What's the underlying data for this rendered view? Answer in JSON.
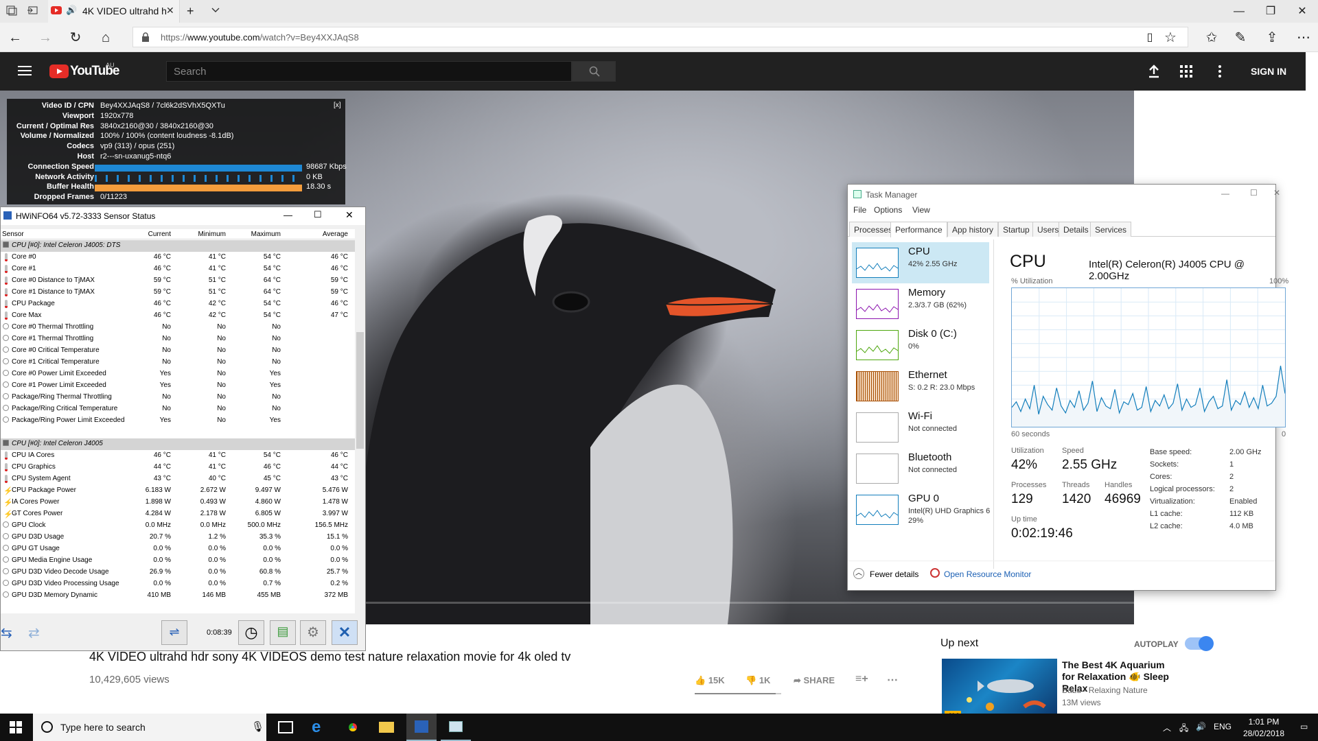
{
  "browser": {
    "tab_title": "4K VIDEO ultrahd h",
    "url_prefix": "https://",
    "url_domain": "www.youtube.com",
    "url_path": "/watch?v=Bey4XXJAqS8"
  },
  "youtube": {
    "brand": "YouTube",
    "country": "AU",
    "search_placeholder": "Search",
    "sign_in": "SIGN IN",
    "stats": [
      {
        "label": "Video ID / CPN",
        "value": "Bey4XXJAqS8 / 7cl6k2dSVhX5QXTu"
      },
      {
        "label": "Viewport",
        "value": "1920x778"
      },
      {
        "label": "Current / Optimal Res",
        "value": "3840x2160@30 / 3840x2160@30"
      },
      {
        "label": "Volume / Normalized",
        "value": "100% / 100% (content loudness -8.1dB)"
      },
      {
        "label": "Codecs",
        "value": "vp9 (313) / opus (251)"
      },
      {
        "label": "Host",
        "value": "r2---sn-uxanug5-ntq6"
      },
      {
        "label": "Connection Speed",
        "value": "98687 Kbps"
      },
      {
        "label": "Network Activity",
        "value": "0 KB"
      },
      {
        "label": "Buffer Health",
        "value": "18.30 s"
      },
      {
        "label": "Dropped Frames",
        "value": "0/11223"
      }
    ],
    "stats_close": "[x]",
    "video_title": "4K VIDEO ultrahd hdr sony 4K VIDEOS demo test nature relaxation movie for 4k oled tv",
    "views": "10,429,605 views",
    "likes": "15K",
    "dislikes": "1K",
    "share": "SHARE",
    "up_next": "Up next",
    "autoplay": "AUTOPLAY",
    "rec": {
      "title": "The Best 4K Aquarium for Relaxation 🐠 Sleep Relax",
      "channel": "BaLu - Relaxing Nature",
      "views": "13M views",
      "badge": "4K"
    }
  },
  "hwinfo": {
    "title": "HWiNFO64 v5.72-3333 Sensor Status",
    "headers": [
      "Sensor",
      "Current",
      "Minimum",
      "Maximum",
      "Average"
    ],
    "rows": [
      {
        "type": "section",
        "name": "CPU [#0]: Intel Celeron J4005: DTS"
      },
      {
        "type": "temp",
        "name": "Core #0",
        "cur": "46 °C",
        "min": "41 °C",
        "max": "54 °C",
        "avg": "46 °C"
      },
      {
        "type": "temp",
        "name": "Core #1",
        "cur": "46 °C",
        "min": "41 °C",
        "max": "54 °C",
        "avg": "46 °C"
      },
      {
        "type": "temp",
        "name": "Core #0 Distance to TjMAX",
        "cur": "59 °C",
        "min": "51 °C",
        "max": "64 °C",
        "avg": "59 °C"
      },
      {
        "type": "temp",
        "name": "Core #1 Distance to TjMAX",
        "cur": "59 °C",
        "min": "51 °C",
        "max": "64 °C",
        "avg": "59 °C"
      },
      {
        "type": "temp",
        "name": "CPU Package",
        "cur": "46 °C",
        "min": "42 °C",
        "max": "54 °C",
        "avg": "46 °C"
      },
      {
        "type": "temp",
        "name": "Core Max",
        "cur": "46 °C",
        "min": "42 °C",
        "max": "54 °C",
        "avg": "47 °C"
      },
      {
        "type": "flag",
        "name": "Core #0 Thermal Throttling",
        "cur": "No",
        "min": "No",
        "max": "No",
        "avg": ""
      },
      {
        "type": "flag",
        "name": "Core #1 Thermal Throttling",
        "cur": "No",
        "min": "No",
        "max": "No",
        "avg": ""
      },
      {
        "type": "flag",
        "name": "Core #0 Critical Temperature",
        "cur": "No",
        "min": "No",
        "max": "No",
        "avg": ""
      },
      {
        "type": "flag",
        "name": "Core #1 Critical Temperature",
        "cur": "No",
        "min": "No",
        "max": "No",
        "avg": ""
      },
      {
        "type": "flag",
        "name": "Core #0 Power Limit Exceeded",
        "cur": "Yes",
        "min": "No",
        "max": "Yes",
        "avg": ""
      },
      {
        "type": "flag",
        "name": "Core #1 Power Limit Exceeded",
        "cur": "Yes",
        "min": "No",
        "max": "Yes",
        "avg": ""
      },
      {
        "type": "flag",
        "name": "Package/Ring Thermal Throttling",
        "cur": "No",
        "min": "No",
        "max": "No",
        "avg": ""
      },
      {
        "type": "flag",
        "name": "Package/Ring Critical Temperature",
        "cur": "No",
        "min": "No",
        "max": "No",
        "avg": ""
      },
      {
        "type": "flag",
        "name": "Package/Ring Power Limit Exceeded",
        "cur": "Yes",
        "min": "No",
        "max": "Yes",
        "avg": ""
      },
      {
        "type": "blank",
        "name": ""
      },
      {
        "type": "section",
        "name": "CPU [#0]: Intel Celeron J4005"
      },
      {
        "type": "temp",
        "name": "CPU IA Cores",
        "cur": "46 °C",
        "min": "41 °C",
        "max": "54 °C",
        "avg": "46 °C"
      },
      {
        "type": "temp",
        "name": "CPU Graphics",
        "cur": "44 °C",
        "min": "41 °C",
        "max": "46 °C",
        "avg": "44 °C"
      },
      {
        "type": "temp",
        "name": "CPU System Agent",
        "cur": "43 °C",
        "min": "40 °C",
        "max": "45 °C",
        "avg": "43 °C"
      },
      {
        "type": "power",
        "name": "CPU Package Power",
        "cur": "6.183 W",
        "min": "2.672 W",
        "max": "9.497 W",
        "avg": "5.476 W"
      },
      {
        "type": "power",
        "name": "IA Cores Power",
        "cur": "1.898 W",
        "min": "0.493 W",
        "max": "4.860 W",
        "avg": "1.478 W"
      },
      {
        "type": "power",
        "name": "GT Cores Power",
        "cur": "4.284 W",
        "min": "2.178 W",
        "max": "6.805 W",
        "avg": "3.997 W"
      },
      {
        "type": "flag",
        "name": "GPU Clock",
        "cur": "0.0 MHz",
        "min": "0.0 MHz",
        "max": "500.0 MHz",
        "avg": "156.5 MHz"
      },
      {
        "type": "flag",
        "name": "GPU D3D Usage",
        "cur": "20.7 %",
        "min": "1.2 %",
        "max": "35.3 %",
        "avg": "15.1 %"
      },
      {
        "type": "flag",
        "name": "GPU GT Usage",
        "cur": "0.0 %",
        "min": "0.0 %",
        "max": "0.0 %",
        "avg": "0.0 %"
      },
      {
        "type": "flag",
        "name": "GPU Media Engine Usage",
        "cur": "0.0 %",
        "min": "0.0 %",
        "max": "0.0 %",
        "avg": "0.0 %"
      },
      {
        "type": "flag",
        "name": "GPU D3D Video Decode Usage",
        "cur": "26.9 %",
        "min": "0.0 %",
        "max": "60.8 %",
        "avg": "25.7 %"
      },
      {
        "type": "flag",
        "name": "GPU D3D Video Processing Usage",
        "cur": "0.0 %",
        "min": "0.0 %",
        "max": "0.7 %",
        "avg": "0.2 %"
      },
      {
        "type": "flag",
        "name": "GPU D3D Memory Dynamic",
        "cur": "410 MB",
        "min": "146 MB",
        "max": "455 MB",
        "avg": "372 MB"
      }
    ],
    "timer": "0:08:39"
  },
  "taskmgr": {
    "title": "Task Manager",
    "menu": [
      "File",
      "Options",
      "View"
    ],
    "tabs": [
      "Processes",
      "Performance",
      "App history",
      "Startup",
      "Users",
      "Details",
      "Services"
    ],
    "active_tab": "Performance",
    "items": [
      {
        "name": "CPU",
        "sub": "42% 2.55 GHz",
        "color": "#117dbb"
      },
      {
        "name": "Memory",
        "sub": "2.3/3.7 GB (62%)",
        "color": "#8b12ae"
      },
      {
        "name": "Disk 0 (C:)",
        "sub": "0%",
        "color": "#4da60c"
      },
      {
        "name": "Ethernet",
        "sub": "S: 0.2  R: 23.0 Mbps",
        "color": "#a74f01"
      },
      {
        "name": "Wi-Fi",
        "sub": "Not connected",
        "color": "#aaaaaa"
      },
      {
        "name": "Bluetooth",
        "sub": "Not connected",
        "color": "#aaaaaa"
      },
      {
        "name": "GPU 0",
        "sub": "Intel(R) UHD Graphics 6",
        "sub2": "29%",
        "color": "#117dbb"
      }
    ],
    "heading": "CPU",
    "cpu_name": "Intel(R) Celeron(R) J4005 CPU @ 2.00GHz",
    "util_label": "% Utilization",
    "util_max": "100%",
    "time_label": "60 seconds",
    "time_min": "0",
    "stats": {
      "utilization_label": "Utilization",
      "utilization": "42%",
      "speed_label": "Speed",
      "speed": "2.55 GHz",
      "processes_label": "Processes",
      "processes": "129",
      "threads_label": "Threads",
      "threads": "1420",
      "handles_label": "Handles",
      "handles": "46969",
      "uptime_label": "Up time",
      "uptime": "0:02:19:46"
    },
    "specs": [
      {
        "k": "Base speed:",
        "v": "2.00 GHz"
      },
      {
        "k": "Sockets:",
        "v": "1"
      },
      {
        "k": "Cores:",
        "v": "2"
      },
      {
        "k": "Logical processors:",
        "v": "2"
      },
      {
        "k": "Virtualization:",
        "v": "Enabled"
      },
      {
        "k": "L1 cache:",
        "v": "112 KB"
      },
      {
        "k": "L2 cache:",
        "v": "4.0 MB"
      }
    ],
    "fewer": "Fewer details",
    "resmon": "Open Resource Monitor",
    "cpu_history": [
      14,
      18,
      11,
      20,
      13,
      30,
      9,
      22,
      16,
      12,
      28,
      15,
      10,
      19,
      14,
      26,
      12,
      17,
      33,
      11,
      21,
      15,
      13,
      27,
      10,
      18,
      16,
      24,
      12,
      14,
      29,
      11,
      19,
      15,
      23,
      13,
      17,
      31,
      12,
      20,
      14,
      16,
      28,
      11,
      18,
      22,
      13,
      15,
      34,
      12,
      19,
      16,
      25,
      14,
      21,
      13,
      30,
      15,
      17,
      22,
      44,
      24
    ]
  },
  "taskbar": {
    "search_placeholder": "Type here to search",
    "lang": "ENG",
    "time": "1:01 PM",
    "date": "28/02/2018"
  }
}
